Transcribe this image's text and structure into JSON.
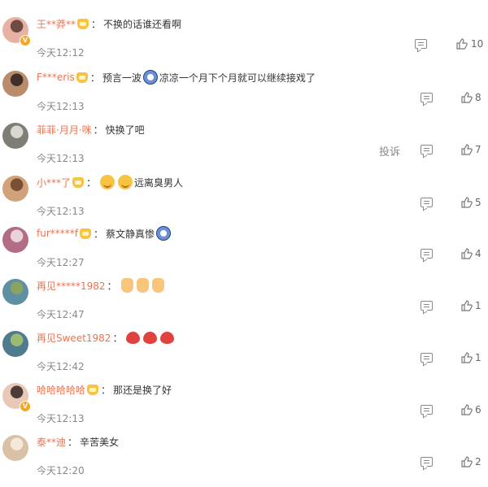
{
  "comments": [
    {
      "user": "王**莽**",
      "text": "不换的话谁还看啊",
      "time": "今天12:12",
      "likes": "10",
      "vip": true,
      "crown": true,
      "emojis": [],
      "avatar": "#e7b2a4",
      "avatar2": "#6f4b44"
    },
    {
      "user": "F***eris",
      "text": "预言一波",
      "text2": "凉凉一个月下个月就可以继续接戏了",
      "time": "今天12:13",
      "likes": "8",
      "vip": false,
      "crown": true,
      "emojis": [
        "cry"
      ],
      "avatar": "#b98c6c",
      "avatar2": "#40302a"
    },
    {
      "user": "菲菲·月月·咪",
      "text": "快换了吧",
      "time": "今天12:13",
      "likes": "7",
      "vip": false,
      "crown": false,
      "emojis": [],
      "avatar": "#7f7e76",
      "avatar2": "#d8d8d0",
      "report": "投诉"
    },
    {
      "user": "小***了",
      "text": "远离臭男人",
      "time": "今天12:13",
      "likes": "5",
      "vip": false,
      "crown": true,
      "emojis": [
        "smile",
        "smile"
      ],
      "avatar": "#d1a17a",
      "avatar2": "#7a4f35"
    },
    {
      "user": "fur*****f",
      "text": "蔡文静真惨",
      "time": "今天12:27",
      "likes": "4",
      "vip": false,
      "crown": true,
      "emojis": [
        "cry_after"
      ],
      "avatar": "#b16c86",
      "avatar2": "#e9d3d8"
    },
    {
      "user": "再见*****1982",
      "text": "",
      "time": "今天12:47",
      "likes": "1",
      "vip": false,
      "crown": false,
      "emojis": [
        "thumb",
        "thumb",
        "thumb"
      ],
      "avatar": "#5f8fa3",
      "avatar2": "#8aa460"
    },
    {
      "user": "再见Sweet1982",
      "text": "",
      "time": "今天12:42",
      "likes": "1",
      "vip": false,
      "crown": false,
      "emojis": [
        "heart",
        "heart",
        "heart"
      ],
      "avatar": "#4f7b8e",
      "avatar2": "#9cbb72"
    },
    {
      "user": "哈哈哈哈哈",
      "text": "那还是换了好",
      "time": "今天12:13",
      "likes": "6",
      "vip": true,
      "crown": true,
      "emojis": [],
      "avatar": "#e9c8b8",
      "avatar2": "#4d3b38"
    },
    {
      "user": "泰**迪",
      "text": "辛苦美女",
      "time": "今天12:20",
      "likes": "2",
      "vip": false,
      "crown": false,
      "emojis": [],
      "avatar": "#d8c1a5",
      "avatar2": "#f3e8da"
    }
  ],
  "icons": {
    "comment": "comment-icon",
    "like": "thumbs-up-icon",
    "vip": "verified-badge-icon",
    "crown": "vip-crown-icon"
  },
  "colors": {
    "username": "#eb7350",
    "time": "#888888",
    "text": "#333333"
  }
}
